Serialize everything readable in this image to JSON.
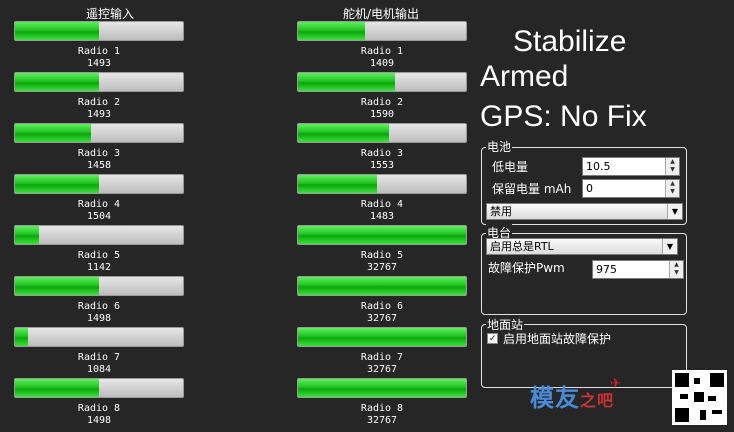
{
  "headers": {
    "input": "遥控输入",
    "output": "舵机/电机输出"
  },
  "radio_in": [
    {
      "label": "Radio 1",
      "value": "1493",
      "fill": 0.5
    },
    {
      "label": "Radio 2",
      "value": "1493",
      "fill": 0.5
    },
    {
      "label": "Radio 3",
      "value": "1458",
      "fill": 0.45
    },
    {
      "label": "Radio 4",
      "value": "1504",
      "fill": 0.5
    },
    {
      "label": "Radio 5",
      "value": "1142",
      "fill": 0.14
    },
    {
      "label": "Radio 6",
      "value": "1498",
      "fill": 0.5
    },
    {
      "label": "Radio 7",
      "value": "1084",
      "fill": 0.08
    },
    {
      "label": "Radio 8",
      "value": "1498",
      "fill": 0.5
    }
  ],
  "servo_out": [
    {
      "label": "Radio 1",
      "value": "1409",
      "fill": 0.4
    },
    {
      "label": "Radio 2",
      "value": "1590",
      "fill": 0.58
    },
    {
      "label": "Radio 3",
      "value": "1553",
      "fill": 0.54
    },
    {
      "label": "Radio 4",
      "value": "1483",
      "fill": 0.47
    },
    {
      "label": "Radio 5",
      "value": "32767",
      "fill": 1.0
    },
    {
      "label": "Radio 6",
      "value": "32767",
      "fill": 1.0
    },
    {
      "label": "Radio 7",
      "value": "32767",
      "fill": 1.0
    },
    {
      "label": "Radio 8",
      "value": "32767",
      "fill": 1.0
    }
  ],
  "status": {
    "mode": "Stabilize",
    "armed": "Armed",
    "gps": "GPS: No Fix"
  },
  "battery": {
    "title": "电池",
    "low_label": "低电量",
    "low_value": "10.5",
    "reserve_label": "保留电量 mAh",
    "reserve_value": "0",
    "action": "禁用"
  },
  "radio": {
    "title": "电台",
    "action": "启用总是RTL",
    "fs_pwm_label": "故障保护Pwm",
    "fs_pwm_value": "975"
  },
  "gcs": {
    "title": "地面站",
    "checkbox_label": "启用地面站故障保护",
    "checked": true
  },
  "watermark": {
    "text": "模友",
    "suffix": "之吧"
  }
}
